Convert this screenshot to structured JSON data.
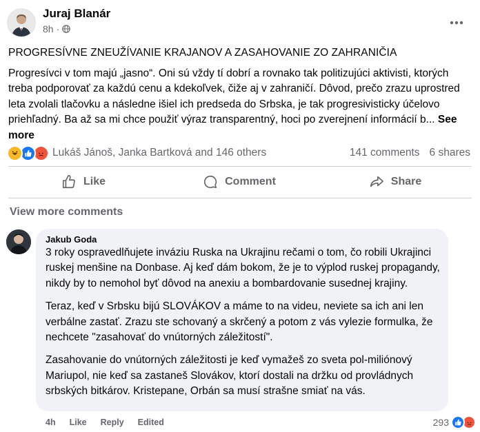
{
  "post": {
    "author": "Juraj Blanár",
    "time": "8h",
    "separator": "·",
    "menu_icon": "more-dots-icon",
    "title": "PROGRESÍVNE ZNEUŽÍVANIE KRAJANOV A ZASAHOVANIE ZO ZAHRANIČIA",
    "body": "Progresívci v tom majú „jasno“. Oni sú vždy tí dobrí a rovnako tak politizujúci aktivisti, ktorých treba podporovať za každú cenu a kdekoľvek, čiže aj v zahraničí. Dôvod, prečo zrazu uprostred leta zvolali tlačovku a následne išiel ich predseda do Srbska, je tak progresivisticky účelovo priehľadný. Ba až sa mi chce použiť výraz transparentný, hoci po zverejnení informácií b...",
    "see_more": "See more",
    "reaction_names": "Lukáš Jánoš, Janka Bartková and 146 others",
    "comments_count": "141 comments",
    "shares_count": "6 shares",
    "reactions": [
      "haha",
      "like",
      "angry"
    ]
  },
  "actions": {
    "like": "Like",
    "comment": "Comment",
    "share": "Share"
  },
  "comments_section": {
    "view_more": "View more comments"
  },
  "comment": {
    "author": "Jakub Goda",
    "paragraphs": [
      "3 roky ospravedlňujete inváziu Ruska na Ukrajinu rečami o tom, čo robili Ukrajinci ruskej menšine na Donbase. Aj keď dám bokom, že je to výplod ruskej propagandy, nikdy by to nemohol byť dôvod na anexiu a bombardovanie susednej krajiny.",
      "Teraz, keď v Srbsku bijú SLOVÁKOV a máme to na videu, neviete sa ich ani len verbálne zastať. Zrazu ste schovaný a skrčený a potom z vás vylezie formulka, že nechcete \"zasahovať do vnútorných záležitostí\".",
      "Zasahovanie do vnútorných záležitosti je keď vymažeš zo sveta pol-miliónový Mariupol, nie keď sa zastaneš Slovákov, ktorí dostali na držku od provládnych srbských bitkárov. Kristepane, Orbán sa musí strašne smiať na vás."
    ],
    "time": "4h",
    "like": "Like",
    "reply": "Reply",
    "edited": "Edited",
    "reaction_count": "293"
  },
  "colors": {
    "like_blue": "#1877f2",
    "haha_yellow": "#f7b928",
    "angry_orange": "#f0533c",
    "secondary_text": "#65676b"
  }
}
